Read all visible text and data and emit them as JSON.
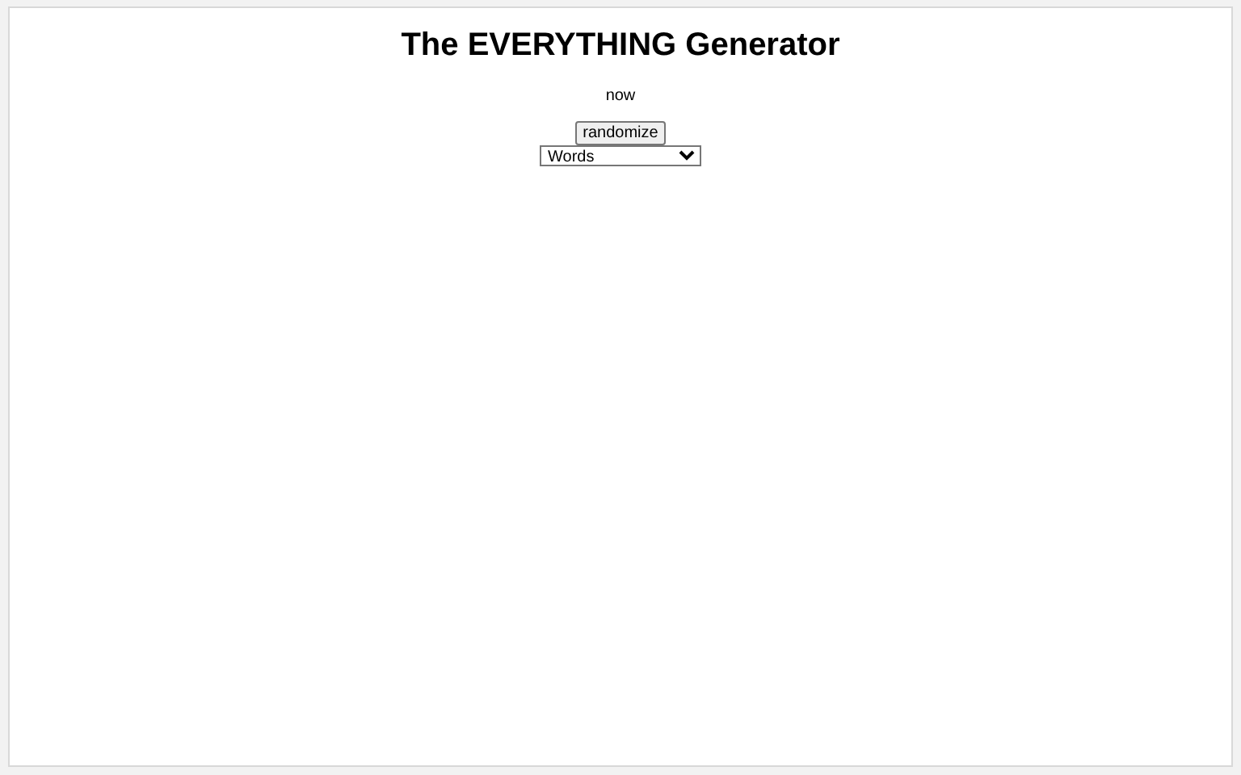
{
  "title": "The EVERYTHING Generator",
  "result": "now",
  "randomize_button": "randomize",
  "category_select": {
    "value": "Words"
  }
}
